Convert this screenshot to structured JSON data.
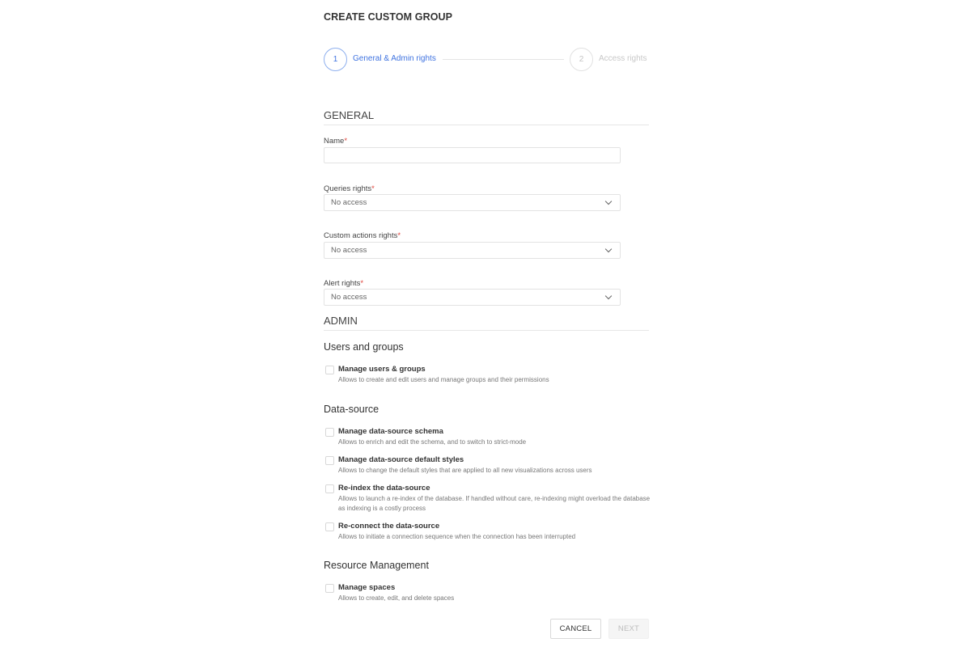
{
  "page": {
    "title": "CREATE CUSTOM GROUP"
  },
  "stepper": {
    "steps": [
      {
        "number": "1",
        "label": "General & Admin rights",
        "state": "active"
      },
      {
        "number": "2",
        "label": "Access rights",
        "state": "inactive"
      }
    ],
    "accent_color": "#3f73e0"
  },
  "general": {
    "section_title": "GENERAL",
    "fields": {
      "name": {
        "label": "Name",
        "required_mark": "*",
        "value": "",
        "placeholder": ""
      },
      "queries_rights": {
        "label": "Queries rights",
        "required_mark": "*",
        "value": "No access"
      },
      "custom_actions_rights": {
        "label": "Custom actions rights",
        "required_mark": "*",
        "value": "No access"
      },
      "alert_rights": {
        "label": "Alert rights",
        "required_mark": "*",
        "value": "No access"
      }
    }
  },
  "admin": {
    "section_title": "ADMIN",
    "groups": [
      {
        "title": "Users and groups",
        "items": [
          {
            "title": "Manage users & groups",
            "description": "Allows to create and edit users and manage groups and their permissions",
            "checked": false
          }
        ]
      },
      {
        "title": "Data-source",
        "items": [
          {
            "title": "Manage data-source schema",
            "description": "Allows to enrich and edit the schema, and to switch to strict-mode",
            "checked": false
          },
          {
            "title": "Manage data-source default styles",
            "description": "Allows to change the default styles that are applied to all new visualizations across users",
            "checked": false
          },
          {
            "title": "Re-index the data-source",
            "description": "Allows to launch a re-index of the database. If handled without care, re-indexing might overload the database as indexing is a costly process",
            "checked": false
          },
          {
            "title": "Re-connect the data-source",
            "description": "Allows to initiate a connection sequence when the connection has been interrupted",
            "checked": false
          }
        ]
      },
      {
        "title": "Resource Management",
        "items": [
          {
            "title": "Manage spaces",
            "description": "Allows to create, edit, and delete spaces",
            "checked": false
          }
        ]
      }
    ]
  },
  "footer": {
    "cancel_label": "CANCEL",
    "next_label": "NEXT",
    "next_disabled": true
  },
  "colors": {
    "required": "#e0433a",
    "text": "#333333",
    "muted": "#777777"
  }
}
